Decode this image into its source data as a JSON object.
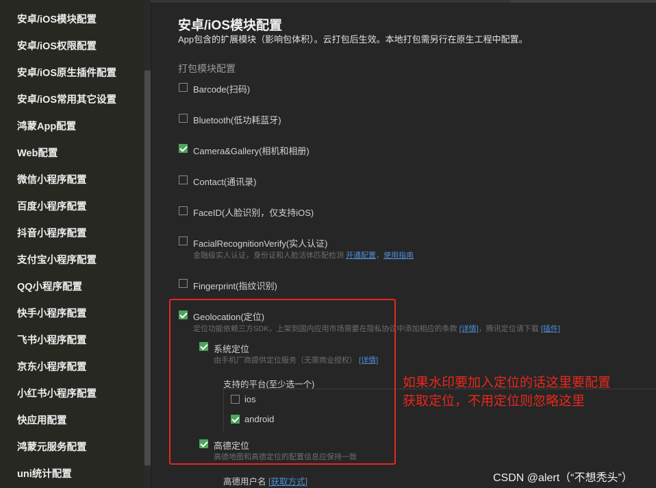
{
  "sidebar": {
    "items": [
      "安卓/iOS模块配置",
      "安卓/iOS权限配置",
      "安卓/iOS原生插件配置",
      "安卓/iOS常用其它设置",
      "鸿蒙App配置",
      "Web配置",
      "微信小程序配置",
      "百度小程序配置",
      "抖音小程序配置",
      "支付宝小程序配置",
      "QQ小程序配置",
      "快手小程序配置",
      "飞书小程序配置",
      "京东小程序配置",
      "小红书小程序配置",
      "快应用配置",
      "鸿蒙元服务配置",
      "uni统计配置"
    ]
  },
  "main": {
    "title": "安卓/iOS模块配置",
    "subtitle": "App包含的扩展模块（影响包体积）。云打包后生效。本地打包需另行在原生工程中配置。",
    "section": "打包模块配置",
    "modules": {
      "barcode": {
        "label": "Barcode(扫码)",
        "checked": false
      },
      "bluetooth": {
        "label": "Bluetooth(低功耗蓝牙)",
        "checked": false
      },
      "camera": {
        "label": "Camera&Gallery(相机和相册)",
        "checked": true
      },
      "contact": {
        "label": "Contact(通讯录)",
        "checked": false
      },
      "faceid": {
        "label": "FaceID(人脸识别，仅支持iOS)",
        "checked": false
      },
      "facial": {
        "label": "FacialRecognitionVerify(实人认证)",
        "checked": false,
        "hint": "金融级实人认证，身份证和人脸活体匹配检测",
        "link1": "开通配置",
        "sep": "，",
        "link2": "使用指南"
      },
      "fingerprint": {
        "label": "Fingerprint(指纹识别)",
        "checked": false
      },
      "geolocation": {
        "label": "Geolocation(定位)",
        "checked": true,
        "hint": "定位功能依赖三方SDK，上架到国内应用市场需要在隐私协议中添加相应的条款",
        "link1": "[详情]",
        "mid": "，腾讯定位请下载",
        "link2": "[插件]",
        "system": {
          "label": "系统定位",
          "checked": true,
          "hint": "由手机厂商提供定位服务（无需商业授权）",
          "link": "[详情]"
        },
        "platforms_label": "支持的平台(至少选一个)",
        "ios": {
          "label": "ios",
          "checked": false
        },
        "android": {
          "label": "android",
          "checked": true
        },
        "amap": {
          "label": "高德定位",
          "checked": true,
          "hint": "高德地图和高德定位的配置信息应保持一致"
        },
        "amap_user_label": "高德用户名",
        "amap_user_link": "[获取方式]"
      }
    }
  },
  "annotation": {
    "line1": "如果水印要加入定位的话这里要配置",
    "line2": "获取定位，不用定位则忽略这里",
    "color": "#e8281d"
  },
  "watermark": "CSDN @alert（“不想秃头”）"
}
